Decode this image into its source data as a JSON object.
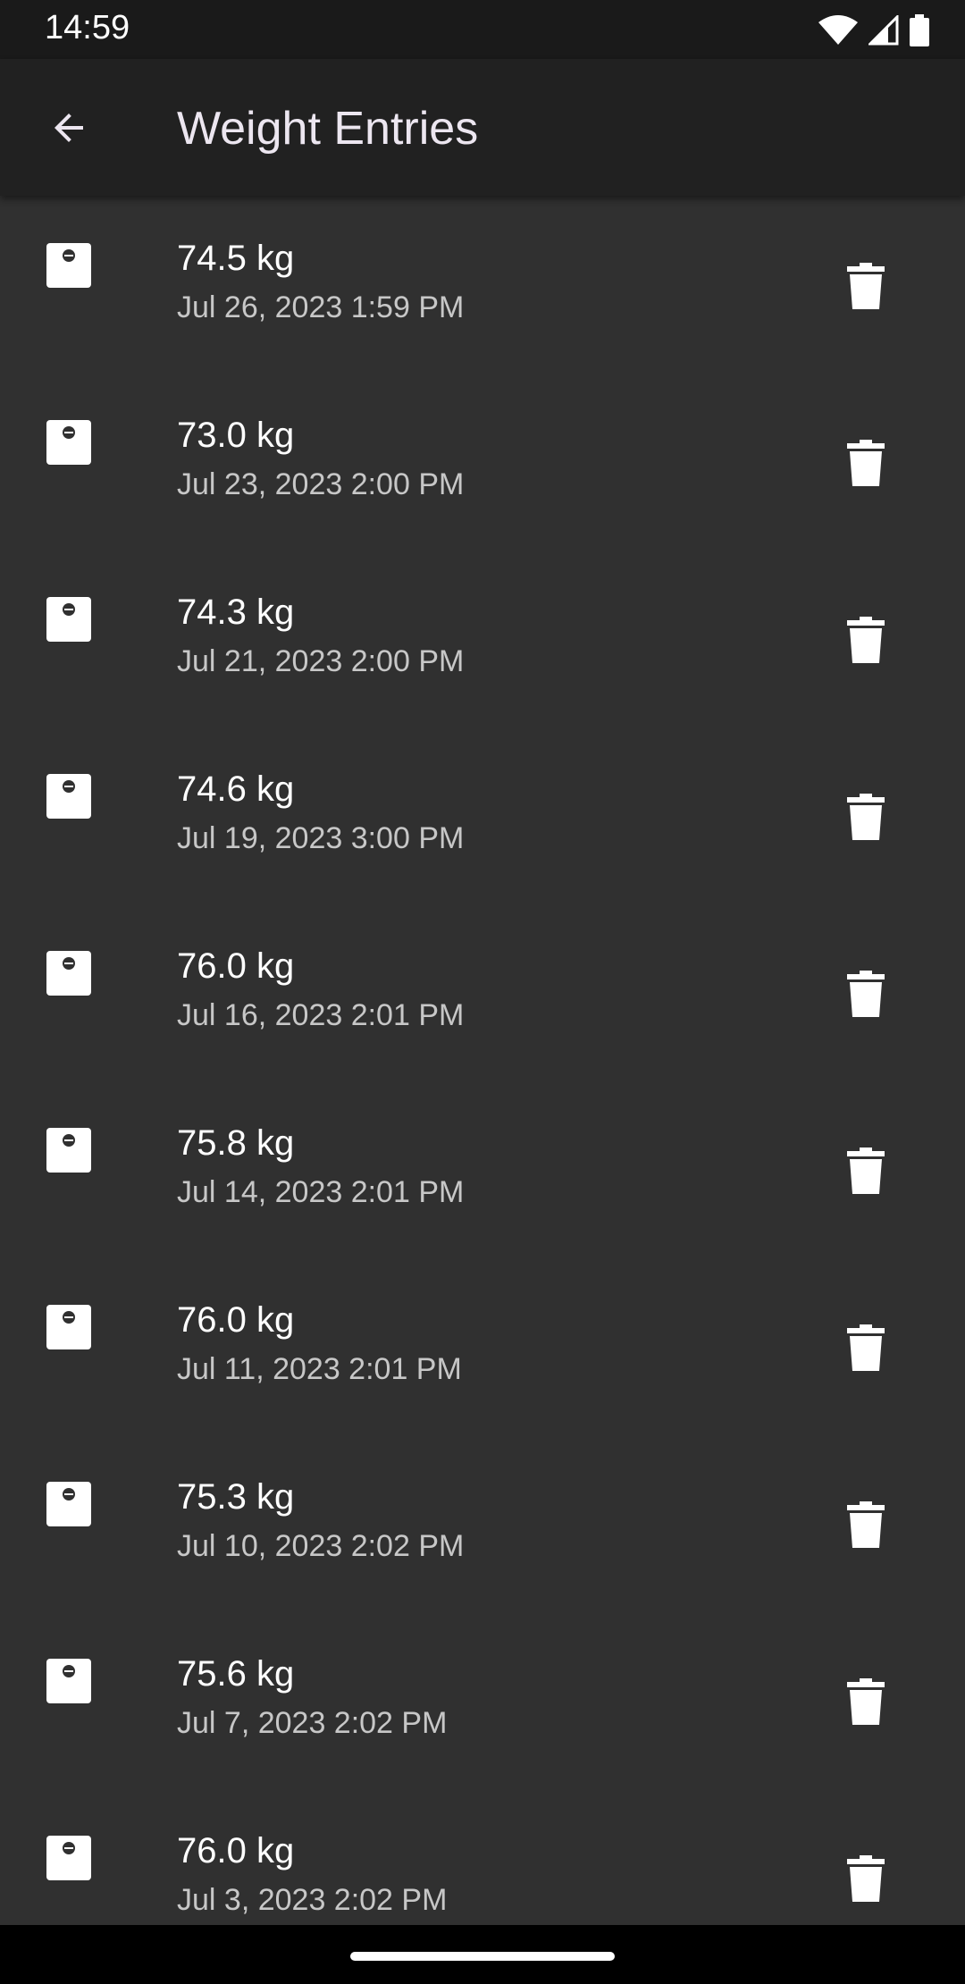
{
  "status_bar": {
    "time": "14:59",
    "icons": [
      "wifi-icon",
      "cellular-signal-icon",
      "battery-icon"
    ]
  },
  "app_bar": {
    "title": "Weight Entries",
    "back_icon": "arrow-back-icon"
  },
  "entries": [
    {
      "weight": "74.5 kg",
      "date": "Jul 26, 2023 1:59 PM"
    },
    {
      "weight": "73.0 kg",
      "date": "Jul 23, 2023 2:00 PM"
    },
    {
      "weight": "74.3 kg",
      "date": "Jul 21, 2023 2:00 PM"
    },
    {
      "weight": "74.6 kg",
      "date": "Jul 19, 2023 3:00 PM"
    },
    {
      "weight": "76.0 kg",
      "date": "Jul 16, 2023 2:01 PM"
    },
    {
      "weight": "75.8 kg",
      "date": "Jul 14, 2023 2:01 PM"
    },
    {
      "weight": "76.0 kg",
      "date": "Jul 11, 2023 2:01 PM"
    },
    {
      "weight": "75.3 kg",
      "date": "Jul 10, 2023 2:02 PM"
    },
    {
      "weight": "75.6 kg",
      "date": "Jul 7, 2023 2:02 PM"
    },
    {
      "weight": "76.0 kg",
      "date": "Jul 3, 2023 2:02 PM"
    }
  ],
  "row_icons": {
    "leading": "scale-icon",
    "trailing": "delete-icon"
  },
  "colors": {
    "background": "#303030",
    "app_bar": "#212121",
    "status_bar": "#1a1a1a",
    "title_text": "#ece6f0",
    "secondary_text": "#c7c7c7"
  }
}
